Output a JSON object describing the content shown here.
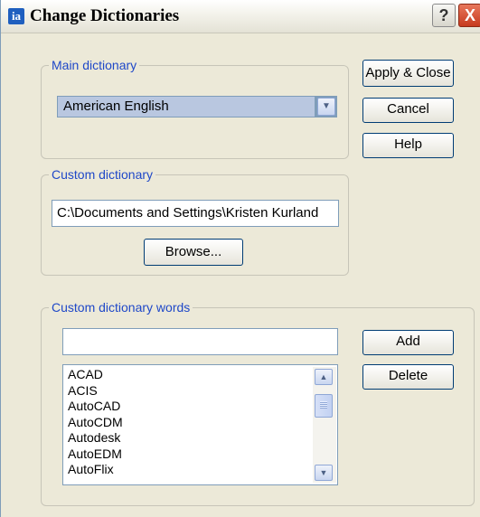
{
  "window": {
    "title": "Change Dictionaries",
    "help_glyph": "?",
    "close_glyph": "X",
    "app_icon_glyph": "ia"
  },
  "main_dictionary": {
    "legend": "Main dictionary",
    "selected": "American English"
  },
  "custom_dictionary": {
    "legend": "Custom dictionary",
    "path": "C:\\Documents and Settings\\Kristen Kurland",
    "browse_label": "Browse..."
  },
  "custom_words": {
    "legend": "Custom dictionary words",
    "input_value": "",
    "add_label": "Add",
    "delete_label": "Delete",
    "items": [
      "ACAD",
      "ACIS",
      "AutoCAD",
      "AutoCDM",
      "Autodesk",
      "AutoEDM",
      "AutoFlix"
    ]
  },
  "buttons": {
    "apply_close": "Apply & Close",
    "cancel": "Cancel",
    "help": "Help"
  },
  "icons": [
    "app-icon",
    "help-icon",
    "close-icon",
    "chevron-down-icon",
    "scroll-up-icon",
    "scroll-down-icon"
  ],
  "colors": {
    "legend": "#1f48c8",
    "selection": "#b9c7e0",
    "button_border": "#003c74"
  }
}
